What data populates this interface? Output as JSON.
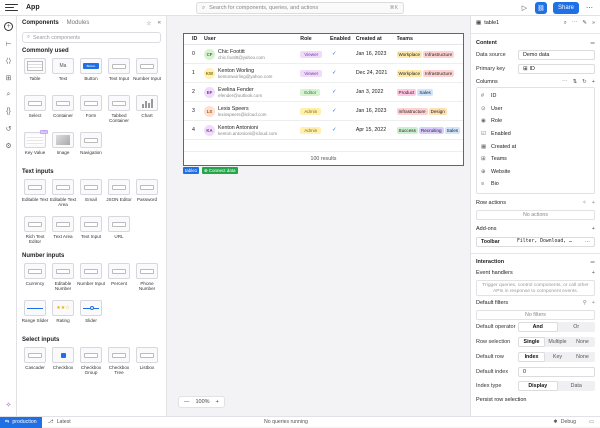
{
  "app": {
    "title": "App",
    "search_placeholder": "Search for components, queries, and actions",
    "search_shortcut": "⌘K",
    "share_label": "Share"
  },
  "left_panel": {
    "title": "Components",
    "subtitle": "Modules",
    "search_placeholder": "Search components",
    "sections": [
      {
        "title": "Commonly used",
        "items": [
          "Table",
          "Text",
          "Button",
          "Text Input",
          "Number Input",
          "Select",
          "Container",
          "Form",
          "Tabbed Container",
          "Chart",
          "Key Value",
          "Image",
          "Navigation"
        ]
      },
      {
        "title": "Text inputs",
        "items": [
          "Editable Text",
          "Editable Text Area",
          "Email",
          "JSON Editor",
          "Password",
          "Rich Text Editor",
          "Text Area",
          "Text Input",
          "URL"
        ]
      },
      {
        "title": "Number inputs",
        "items": [
          "Currency",
          "Editable Number",
          "Number Input",
          "Percent",
          "Phone Number",
          "Range Slider",
          "Rating",
          "Slider"
        ]
      },
      {
        "title": "Select inputs",
        "items": [
          "Cascader",
          "Checkbox",
          "Checkbox Group",
          "Checkbox Tree",
          "Listbox"
        ]
      }
    ],
    "button_thumb_text": "Button",
    "new_badge": "New",
    "text_thumb": "Ma"
  },
  "table": {
    "headers": [
      "ID",
      "User",
      "Role",
      "Enabled",
      "Created at",
      "Teams"
    ],
    "rows": [
      {
        "id": "0",
        "initials": "CF",
        "name": "Chic Footitt",
        "email": "chic.footitt@yahoo.com",
        "role": "Viewer",
        "enabled": "✓",
        "created": "Jan 16, 2023",
        "teams": [
          "Workplace",
          "Infrastructure"
        ],
        "avatar_color": "#d6f2d0",
        "avatar_text": "#2e7d32"
      },
      {
        "id": "1",
        "initials": "KW",
        "name": "Kenton Worling",
        "email": "kentonworling@yahoo.com",
        "role": "Viewer",
        "enabled": "✓",
        "created": "Dec 24, 2021",
        "teams": [
          "Workplace",
          "Infrastructure"
        ],
        "avatar_color": "#fff1b8",
        "avatar_text": "#8a6d00"
      },
      {
        "id": "2",
        "initials": "EF",
        "name": "Evelina Fender",
        "email": "efender@outlook.com",
        "role": "Editor",
        "enabled": "✓",
        "created": "Jan 3, 2022",
        "teams": [
          "Product",
          "Sales"
        ],
        "avatar_color": "#f0dcfa",
        "avatar_text": "#7b2fa0"
      },
      {
        "id": "3",
        "initials": "LS",
        "name": "Lexis Speers",
        "email": "lexisspeers@icloud.com",
        "role": "Admin",
        "enabled": "✓",
        "created": "Jan 16, 2023",
        "teams": [
          "Infrastructure",
          "Design"
        ],
        "avatar_color": "#fde0cf",
        "avatar_text": "#b24a12"
      },
      {
        "id": "4",
        "initials": "KA",
        "name": "Kenton Antonioni",
        "email": "kenton.antonioni@icloud.com",
        "role": "Admin",
        "enabled": "✓",
        "created": "Apr 15, 2022",
        "teams": [
          "Success",
          "Recruiting",
          "Sales"
        ],
        "avatar_color": "#f0dcfa",
        "avatar_text": "#7b2fa0"
      }
    ],
    "footer": "100 results",
    "tag_name": "table1",
    "tag_query": "Connect data"
  },
  "zoom": {
    "value": "100%",
    "minus": "—",
    "plus": "+"
  },
  "inspector": {
    "component": "table1",
    "content_label": "Content",
    "data_source_label": "Data source",
    "data_source": "Demo data",
    "primary_key_label": "Primary key",
    "primary_key": "ID",
    "columns_label": "Columns",
    "columns": [
      "ID",
      "User",
      "Role",
      "Enabled",
      "Created at",
      "Teams",
      "Website",
      "Bio"
    ],
    "row_actions_label": "Row actions",
    "no_actions": "No actions",
    "addons_label": "Add-ons",
    "toolbar_label": "Toolbar",
    "toolbar_value": "Filter, Download, …",
    "interaction_label": "Interaction",
    "event_handlers_label": "Event handlers",
    "event_handlers_hint": "Trigger queries, control components, or call other APIs in response to component events.",
    "default_filters_label": "Default filters",
    "no_filters": "No filters",
    "default_operator_label": "Default operator",
    "op_and": "And",
    "op_or": "Or",
    "row_selection_label": "Row selection",
    "rs_single": "Single",
    "rs_multiple": "Multiple",
    "rs_none": "None",
    "default_row_label": "Default row",
    "dr_index": "Index",
    "dr_key": "Key",
    "dr_none": "None",
    "default_index_label": "Default index",
    "default_index": "0",
    "index_type_label": "Index type",
    "it_display": "Display",
    "it_data": "Data",
    "persist_label": "Persist row selection"
  },
  "status": {
    "env": "production",
    "latest": "Latest",
    "queries": "No queries running",
    "debug": "Debug"
  },
  "colors": {
    "accent": "#1f6fe5",
    "viewer": "#f0dcfa",
    "editor": "#d6f2d0",
    "admin": "#fff0b0"
  }
}
